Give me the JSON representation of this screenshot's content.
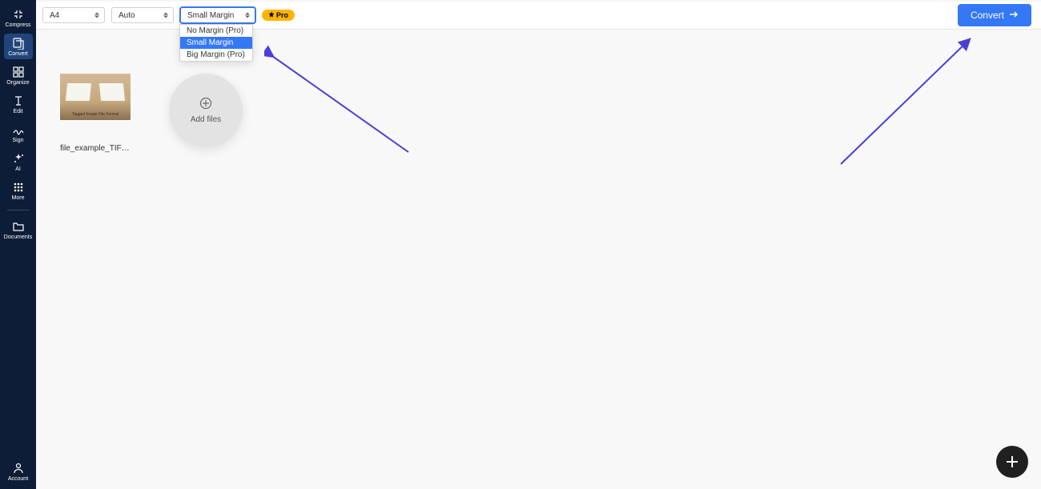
{
  "sidebar": {
    "items": [
      {
        "label": "Compress"
      },
      {
        "label": "Convert"
      },
      {
        "label": "Organize"
      },
      {
        "label": "Edit"
      },
      {
        "label": "Sign"
      },
      {
        "label": "AI"
      },
      {
        "label": "More"
      }
    ],
    "documents_label": "Documents",
    "account_label": "Account"
  },
  "toolbar": {
    "page_size": {
      "selected": "A4"
    },
    "orientation": {
      "selected": "Auto"
    },
    "margin": {
      "selected": "Small Margin",
      "options": [
        "No Margin (Pro)",
        "Small Margin",
        "Big Margin (Pro)"
      ]
    },
    "pro_badge": "Pro",
    "convert_label": "Convert"
  },
  "files": [
    {
      "name": "file_example_TIFF_1…",
      "thumb_caption": "Tagged Image File Format"
    }
  ],
  "add_files_label": "Add files"
}
